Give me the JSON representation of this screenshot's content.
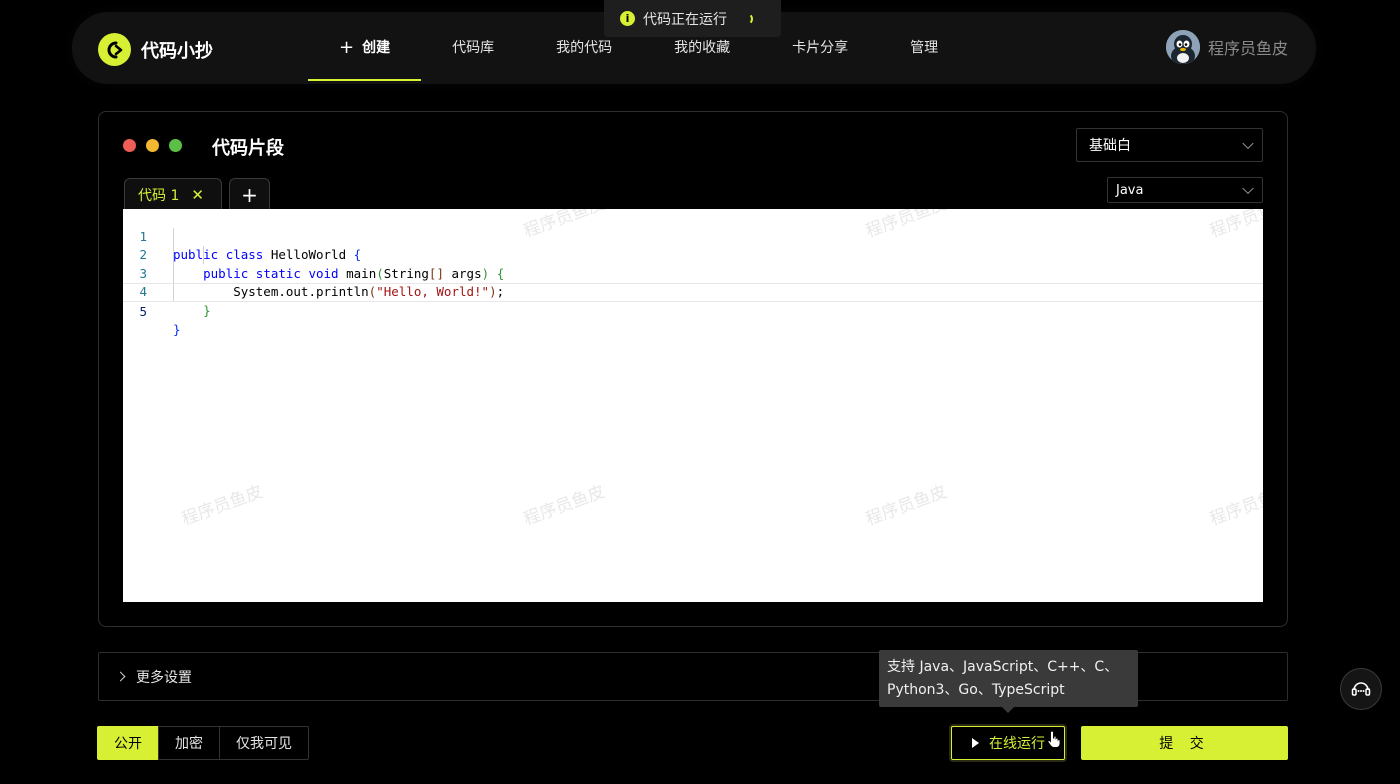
{
  "header": {
    "logo_text": "代码小抄",
    "nav": [
      {
        "label": "创建",
        "active": true,
        "icon": "plus-icon"
      },
      {
        "label": "代码库"
      },
      {
        "label": "我的代码"
      },
      {
        "label": "我的收藏"
      },
      {
        "label": "卡片分享"
      },
      {
        "label": "管理"
      }
    ],
    "user_name": "程序员鱼皮"
  },
  "toast": {
    "text": "代码正在运行",
    "icon": "info-icon"
  },
  "panel": {
    "title": "代码片段",
    "theme_select": "基础白",
    "language_select": "Java",
    "tabs": [
      {
        "label": "代码 1"
      }
    ],
    "add_tab_label": "+",
    "watermark": "程序员鱼皮",
    "code_lines": [
      {
        "num": "1",
        "text": "public class HelloWorld {"
      },
      {
        "num": "2",
        "text": "    public static void main(String[] args) {"
      },
      {
        "num": "3",
        "text": "        System.out.println(\"Hello, World!\");"
      },
      {
        "num": "4",
        "text": "    }"
      },
      {
        "num": "5",
        "text": "}"
      }
    ]
  },
  "more_settings": "更多设置",
  "visibility": {
    "options": [
      "公开",
      "加密",
      "仅我可见"
    ],
    "selected": "公开"
  },
  "tooltip": {
    "line1": "支持 Java、JavaScript、C++、C、",
    "line2": "Python3、Go、TypeScript"
  },
  "buttons": {
    "run": "在线运行",
    "submit": "提 交"
  },
  "colors": {
    "accent": "#d8f034",
    "background": "#000000",
    "header_bg": "#121212"
  }
}
